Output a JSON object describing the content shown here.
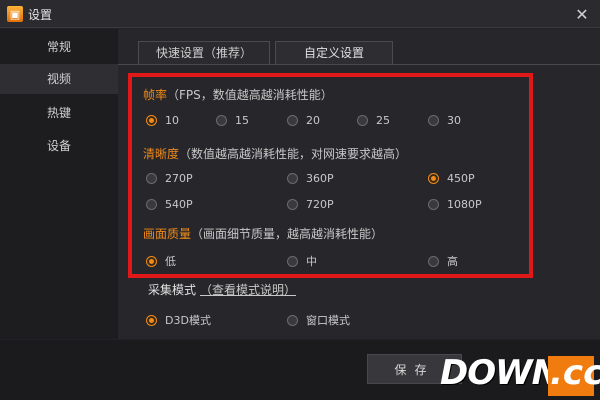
{
  "window": {
    "title": "设置",
    "app_icon_glyph": "▣",
    "close_glyph": "✕"
  },
  "sidebar": {
    "items": [
      {
        "label": "常规",
        "active": false
      },
      {
        "label": "视频",
        "active": true
      },
      {
        "label": "热键",
        "active": false
      },
      {
        "label": "设备",
        "active": false
      }
    ]
  },
  "tabs": [
    {
      "label": "快速设置（推荐）",
      "active": false
    },
    {
      "label": "自定义设置",
      "active": true
    }
  ],
  "fps": {
    "title": "帧率",
    "note": "（FPS，数值越高越消耗性能）",
    "options": [
      "10",
      "15",
      "20",
      "25",
      "30"
    ],
    "selected": "10"
  },
  "resolution": {
    "title": "清晰度",
    "note": "（数值越高越消耗性能，对网速要求越高）",
    "options": [
      "270P",
      "360P",
      "450P",
      "540P",
      "720P",
      "1080P"
    ],
    "selected": "450P"
  },
  "quality": {
    "title": "画面质量",
    "note": "（画面细节质量，越高越消耗性能）",
    "options": [
      "低",
      "中",
      "高"
    ],
    "selected": "低"
  },
  "capture": {
    "title": "采集模式",
    "link": "（查看模式说明）",
    "options": [
      "D3D模式",
      "窗口模式"
    ],
    "selected": "D3D模式"
  },
  "footer": {
    "save_label": "保存"
  },
  "watermark": {
    "text": "DOWN",
    "suffix": ".cc"
  },
  "colors": {
    "accent": "#f08a1a",
    "highlight": "#e01818",
    "background": "#222226"
  }
}
